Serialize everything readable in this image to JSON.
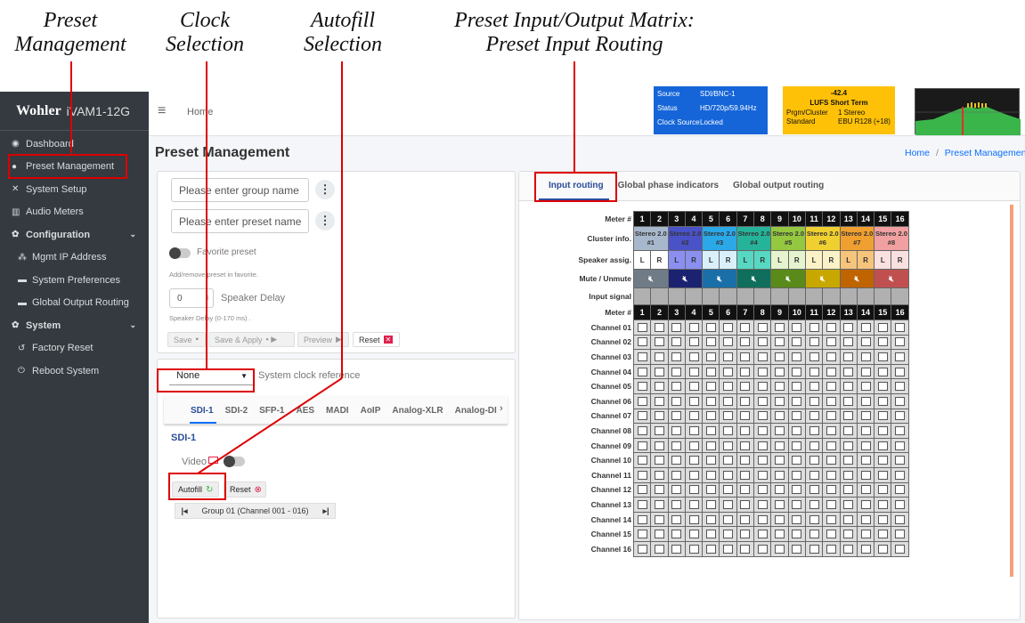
{
  "callouts": [
    {
      "line1": "Preset",
      "line2": "Management"
    },
    {
      "line1": "Clock",
      "line2": "Selection"
    },
    {
      "line1": "Autofill",
      "line2": "Selection"
    },
    {
      "line1": "Preset Input/Output Matrix:",
      "line2": "Preset Input Routing"
    }
  ],
  "brand": {
    "logo": "Wohler",
    "model": "iVAM1-12G"
  },
  "sidebar": {
    "items": [
      {
        "icon": "dashboard-icon",
        "glyph": "◉",
        "label": "Dashboard"
      },
      {
        "icon": "user-gear-icon",
        "glyph": "●",
        "label": "Preset Management"
      },
      {
        "icon": "tools-icon",
        "glyph": "✕",
        "label": "System Setup"
      },
      {
        "icon": "bar-chart-icon",
        "glyph": "▥",
        "label": "Audio Meters"
      },
      {
        "icon": "gear-icon",
        "glyph": "✿",
        "label": "Configuration"
      },
      {
        "icon": "network-icon",
        "glyph": "⁂",
        "label": "Mgmt IP Address"
      },
      {
        "icon": "card-icon",
        "glyph": "▬",
        "label": "System Preferences"
      },
      {
        "icon": "card-icon",
        "glyph": "▬",
        "label": "Global Output Routing"
      },
      {
        "icon": "gears-icon",
        "glyph": "✿",
        "label": "System"
      },
      {
        "icon": "undo-icon",
        "glyph": "↺",
        "label": "Factory Reset"
      },
      {
        "icon": "power-icon",
        "glyph": "⏻",
        "label": "Reboot System"
      }
    ]
  },
  "topbar": {
    "menu_glyph": "≡",
    "home": "Home"
  },
  "status_panel": {
    "source_label": "Source",
    "source": "SDI/BNC-1",
    "status_label": "Status",
    "status": "HD/720p/59.94Hz",
    "clock_label": "Clock Source",
    "clock": "Locked"
  },
  "loudness_panel": {
    "value": "-42.4",
    "title": "LUFS  Short Term",
    "prgm_label": "Prgm/Cluster",
    "prgm": "1  Stereo",
    "std_label": "Standard",
    "std": "EBU R128 (+18)"
  },
  "page": {
    "title": "Preset Management",
    "bc_home": "Home",
    "bc_sep": "/",
    "bc_current": "Preset Management"
  },
  "preset": {
    "group_placeholder": "Please enter group name",
    "preset_placeholder": "Please enter preset name",
    "favorite": "Favorite preset",
    "favorite_help": "Add/remove preset in favorite.",
    "delay_value": "0",
    "delay_label": "Speaker Delay",
    "delay_help": "Speaker Delay (0-170 ms) .",
    "save": "Save",
    "save_apply": "Save & Apply",
    "preview": "Preview",
    "reset": "Reset"
  },
  "clock": {
    "selected": "None",
    "label": "System clock reference"
  },
  "input_tabs": [
    "SDI-1",
    "SDI-2",
    "SFP-1",
    "AES",
    "MADI",
    "AoIP",
    "Analog-XLR",
    "Analog-DI"
  ],
  "sdi": {
    "heading": "SDI-1",
    "video": "Video",
    "autofill": "Autofill",
    "reset": "Reset",
    "group": "Group 01 (Channel 001 - 016)"
  },
  "matrix_tabs": [
    "Input routing",
    "Global phase indicators",
    "Global output routing"
  ],
  "matrix": {
    "row_labels": {
      "meter": "Meter #",
      "cluster": "Cluster info.",
      "speaker": "Speaker assig.",
      "mute": "Mute / Unmute",
      "input": "Input signal"
    },
    "meters": [
      "1",
      "2",
      "3",
      "4",
      "5",
      "6",
      "7",
      "8",
      "9",
      "10",
      "11",
      "12",
      "13",
      "14",
      "15",
      "16"
    ],
    "clusters": [
      {
        "label": "Stereo 2.0",
        "num": "#1",
        "color": "#a8b8cc",
        "speaker": "#ffffff",
        "mute": "#6f7b87"
      },
      {
        "label": "Stereo 2.0",
        "num": "#2",
        "color": "#4a52c8",
        "speaker": "#8a8ff0",
        "mute": "#1b2370"
      },
      {
        "label": "Stereo 2.0",
        "num": "#3",
        "color": "#2aa8e8",
        "speaker": "#d9f0fb",
        "mute": "#1b6fa8"
      },
      {
        "label": "Stereo 2.0",
        "num": "#4",
        "color": "#25b39a",
        "speaker": "#57d8c2",
        "mute": "#0f6e5c"
      },
      {
        "label": "Stereo 2.0",
        "num": "#5",
        "color": "#94c840",
        "speaker": "#e6f3cf",
        "mute": "#5a8a1a"
      },
      {
        "label": "Stereo 2.0",
        "num": "#6",
        "color": "#f0d030",
        "speaker": "#fbf2c8",
        "mute": "#c8a800"
      },
      {
        "label": "Stereo 2.0",
        "num": "#7",
        "color": "#f0a030",
        "speaker": "#f7c47c",
        "mute": "#c06400"
      },
      {
        "label": "Stereo 2.0",
        "num": "#8",
        "color": "#f0a0a0",
        "speaker": "#fbe0e0",
        "mute": "#c05050"
      }
    ],
    "lr": [
      "L",
      "R"
    ],
    "channels": [
      "Channel 01",
      "Channel 02",
      "Channel 03",
      "Channel 04",
      "Channel 05",
      "Channel 06",
      "Channel 07",
      "Channel 08",
      "Channel 09",
      "Channel 10",
      "Channel 11",
      "Channel 12",
      "Channel 13",
      "Channel 14",
      "Channel 15",
      "Channel 16"
    ]
  },
  "colors": {
    "sidebar": "#343a40",
    "accent": "#0d6efd",
    "annotation": "#dd0000",
    "status_blue": "#1565d8",
    "status_yellow": "#ffc107"
  }
}
